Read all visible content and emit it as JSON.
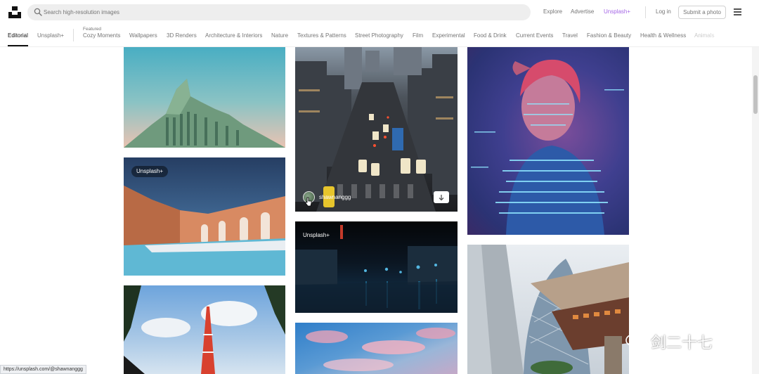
{
  "header": {
    "search_placeholder": "Search high-resolution images",
    "links": {
      "explore": "Explore",
      "advertise": "Advertise",
      "unsplash_plus": "Unsplash+"
    },
    "login": "Log in",
    "submit": "Submit a photo"
  },
  "categories": {
    "editorial": "Editorial",
    "unsplash_plus": "Unsplash+",
    "featured_label": "Featured",
    "items": [
      "Cozy Moments",
      "Wallpapers",
      "3D Renders",
      "Architecture & Interiors",
      "Nature",
      "Textures & Patterns",
      "Street Photography",
      "Film",
      "Experimental",
      "Food & Drink",
      "Current Events",
      "Travel",
      "Fashion & Beauty",
      "Health & Wellness",
      "Animals"
    ]
  },
  "photos": {
    "badge": "Unsplash+",
    "hover_author": "shawnanggg"
  },
  "status_url": "https://unsplash.com/@shawnanggg",
  "watermark": "剑二十七",
  "colors": {
    "plus_accent": "#a566e6",
    "text_muted": "#767676"
  },
  "icons": [
    "logo-icon",
    "search-icon",
    "menu-icon",
    "download-icon",
    "wechat-icon"
  ]
}
